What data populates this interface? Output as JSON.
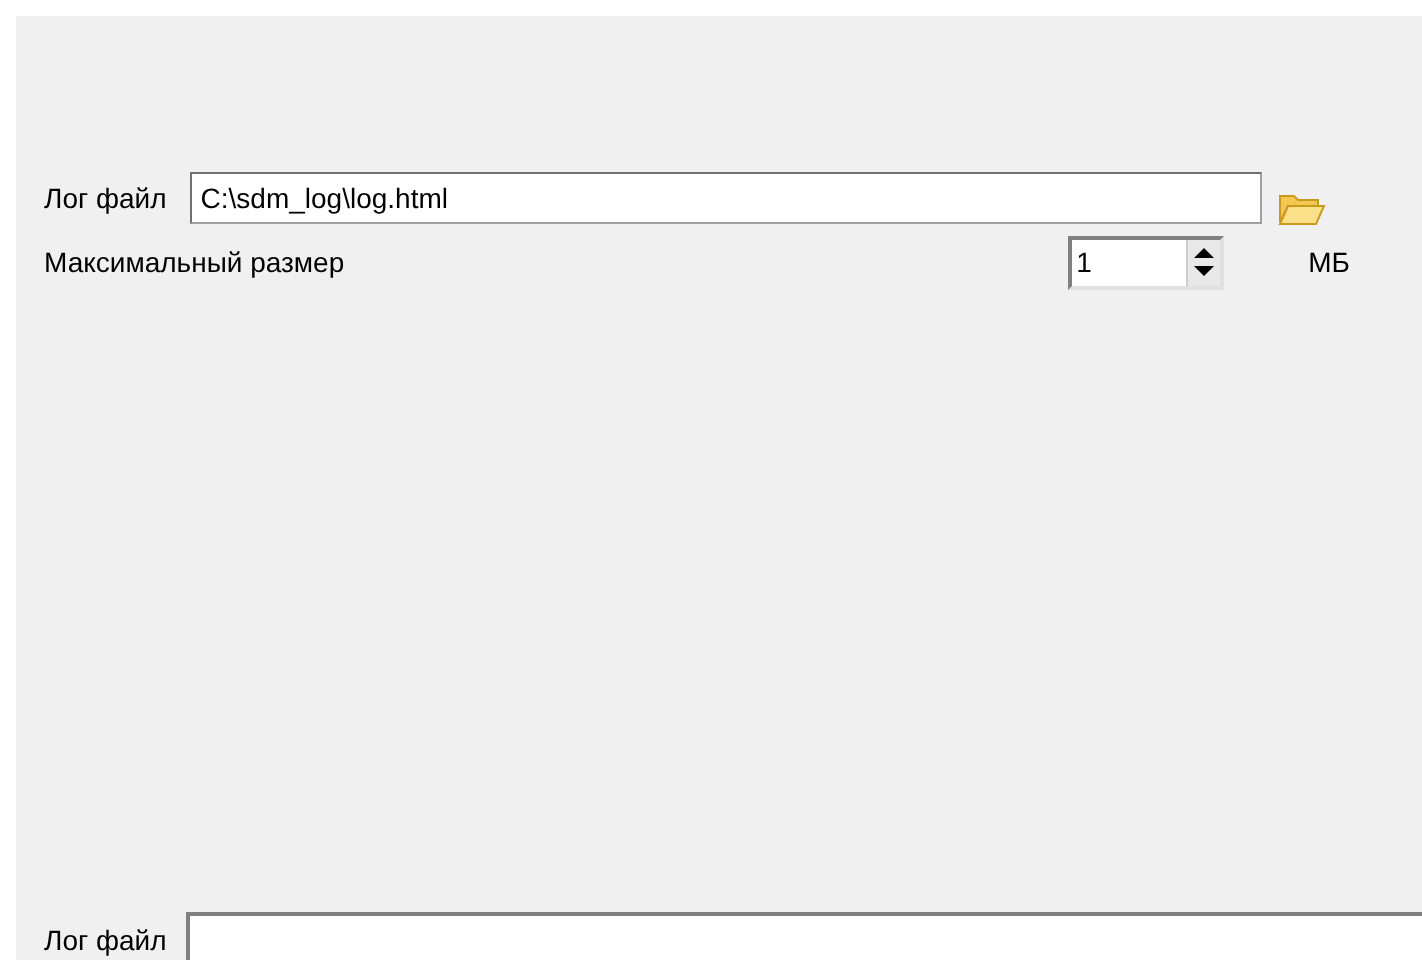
{
  "log_file": {
    "label": "Лог файл",
    "value": "C:\\sdm_log\\log.html"
  },
  "max_size": {
    "label": "Максимальный размер",
    "value": "1",
    "unit": "МБ"
  },
  "log_file_2": {
    "label": "Лог файл"
  }
}
